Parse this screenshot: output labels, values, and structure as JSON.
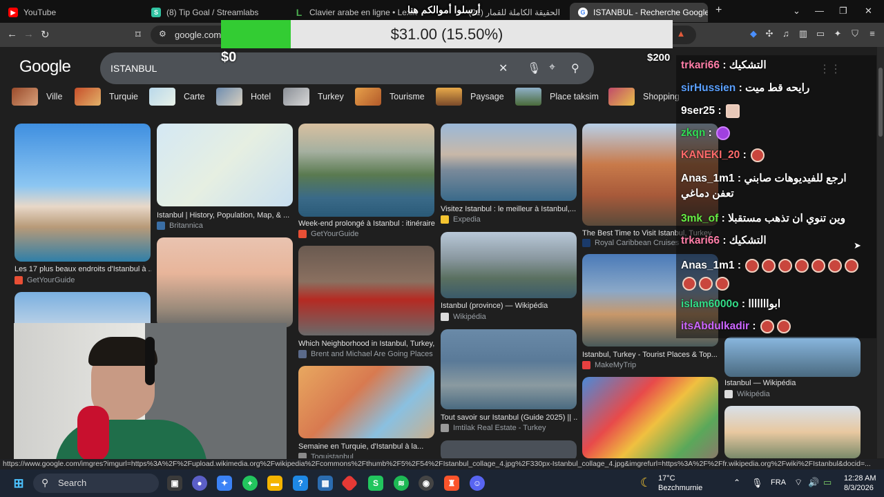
{
  "tabs": [
    {
      "title": "YouTube",
      "active": false
    },
    {
      "title": "(8) Tip Goal / Streamlabs",
      "active": false
    },
    {
      "title": "Clavier arabe en ligne • Lexilogos",
      "active": false
    },
    {
      "title": "(21) الحقيقة الكاملة للقمار",
      "active": false
    },
    {
      "title": "ISTANBUL - Recherche Google",
      "active": true
    }
  ],
  "new_tab": "+",
  "address": {
    "url": "google.com/"
  },
  "donation_goal": {
    "title": "أرسلوا أموالكم هنا",
    "amount_text": "$31.00 (15.50%)",
    "progress": 0.155,
    "min_label": "$0",
    "max_label": "$200"
  },
  "google": {
    "logo": "Google",
    "query": "ISTANBUL",
    "chips": [
      "Ville",
      "Turquie",
      "Carte",
      "Hotel",
      "Turkey",
      "Tourisme",
      "Paysage",
      "Place taksim",
      "Shopping"
    ],
    "results": [
      {
        "caption": "Les 17 plus beaux endroits d'Istanbul à ...",
        "source": "GetYourGuide"
      },
      {
        "caption": "Istanbul | History, Population, Map, & ...",
        "source": "Britannica"
      },
      {
        "caption": "Week-end prolongé à Istanbul : itinéraire...",
        "source": "GetYourGuide"
      },
      {
        "caption": "Visitez Istanbul : le meilleur à Istanbul,...",
        "source": "Expedia"
      },
      {
        "caption": "The Best Time to Visit Istanbul, Turkey",
        "source": "Royal Caribbean Cruises"
      },
      {
        "caption": "Which Neighborhood in Istanbul, Turkey,...",
        "source": "Brent and Michael Are Going Places"
      },
      {
        "caption": "Istanbul (province) — Wikipédia",
        "source": "Wikipédia"
      },
      {
        "caption": "Istanbul, Turkey - Tourist Places & Top...",
        "source": "MakeMyTrip"
      },
      {
        "caption": "Istanbul — Wikipédia",
        "source": "Wikipédia"
      },
      {
        "caption": "Tout savoir sur Istanbul (Guide 2025) || ...",
        "source": "Imtilak Real Estate - Turkey"
      },
      {
        "caption": "Semaine en Turquie, d'Istanbul à la...",
        "source": "Toguistanbul"
      }
    ]
  },
  "chat": [
    {
      "user": "trkari66",
      "color": "#ff7ea8",
      "msg": "التشكيك"
    },
    {
      "user": "sirHussien",
      "color": "#5aa0ff",
      "msg": "رايحه قط ميت"
    },
    {
      "user": "9ser25",
      "color": "#ffffff",
      "msg": ""
    },
    {
      "user": "zkqn",
      "color": "#33dd55",
      "msg": ""
    },
    {
      "user": "KANEKI_20",
      "color": "#ff6b6b",
      "msg": ""
    },
    {
      "user": "Anas_1m1",
      "color": "#ffffff",
      "msg": "ارجع للفيديوهات صابني تعفن دماغي"
    },
    {
      "user": "3mk_of",
      "color": "#66ee44",
      "msg": "وين تنوي ان تذهب مستقبلا"
    },
    {
      "user": "trkari66",
      "color": "#ff7ea8",
      "msg": "التشكيك"
    },
    {
      "user": "Anas_1m1",
      "color": "#ffffff",
      "msg": ""
    },
    {
      "user": "islam6000o",
      "color": "#33dd88",
      "msg": "ابوااااااا"
    },
    {
      "user": "itsAbdulkadir",
      "color": "#cc66ff",
      "msg": ""
    }
  ],
  "status_url": "https://www.google.com/imgres?imgurl=https%3A%2F%2Fupload.wikimedia.org%2Fwikipedia%2Fcommons%2Fthumb%2F5%2F54%2FIstanbul_collage_4.jpg%2F330px-Istanbul_collage_4.jpg&imgrefurl=https%3A%2F%2Ffr.wikipedia.org%2Fwiki%2FIstanbul&docid=...",
  "taskbar": {
    "search_placeholder": "Search",
    "weather_temp": "17°C",
    "weather_place": "Bezchmurnie",
    "language": "FRA",
    "time": "12:28 AM",
    "date": "8/3/2026"
  }
}
